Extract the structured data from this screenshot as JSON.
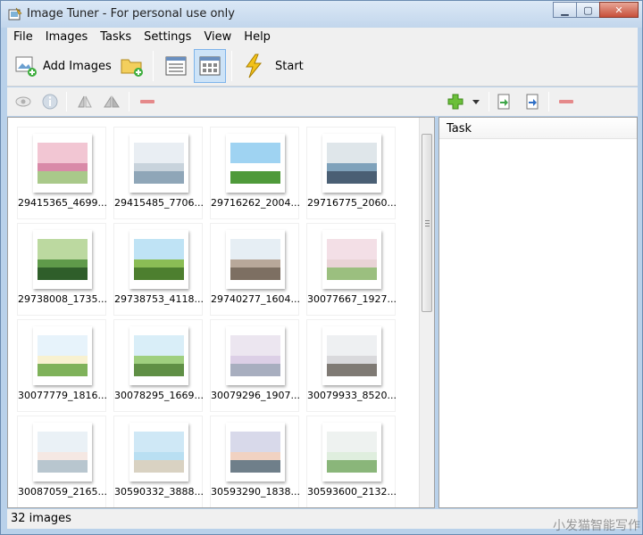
{
  "window": {
    "title": "Image Tuner - For personal use only"
  },
  "menu": [
    "File",
    "Images",
    "Tasks",
    "Settings",
    "View",
    "Help"
  ],
  "toolbar": {
    "add_images": "Add Images",
    "start": "Start"
  },
  "gallery": {
    "items": [
      "29415365_4699...",
      "29415485_7706...",
      "29716262_2004...",
      "29716775_2060...",
      "29738008_1735...",
      "29738753_4118...",
      "29740277_1604...",
      "30077667_1927...",
      "30077779_1816...",
      "30078295_1669...",
      "30079296_1907...",
      "30079933_8520...",
      "30087059_2165...",
      "30590332_3888...",
      "30593290_1838...",
      "30593600_2132..."
    ]
  },
  "task_panel": {
    "header": "Task"
  },
  "status": {
    "count": "32 images"
  },
  "watermark": "小发猫智能写作",
  "colors": {
    "selected_view": "#cde3f7",
    "title_gradient": "#c2d6ec"
  }
}
